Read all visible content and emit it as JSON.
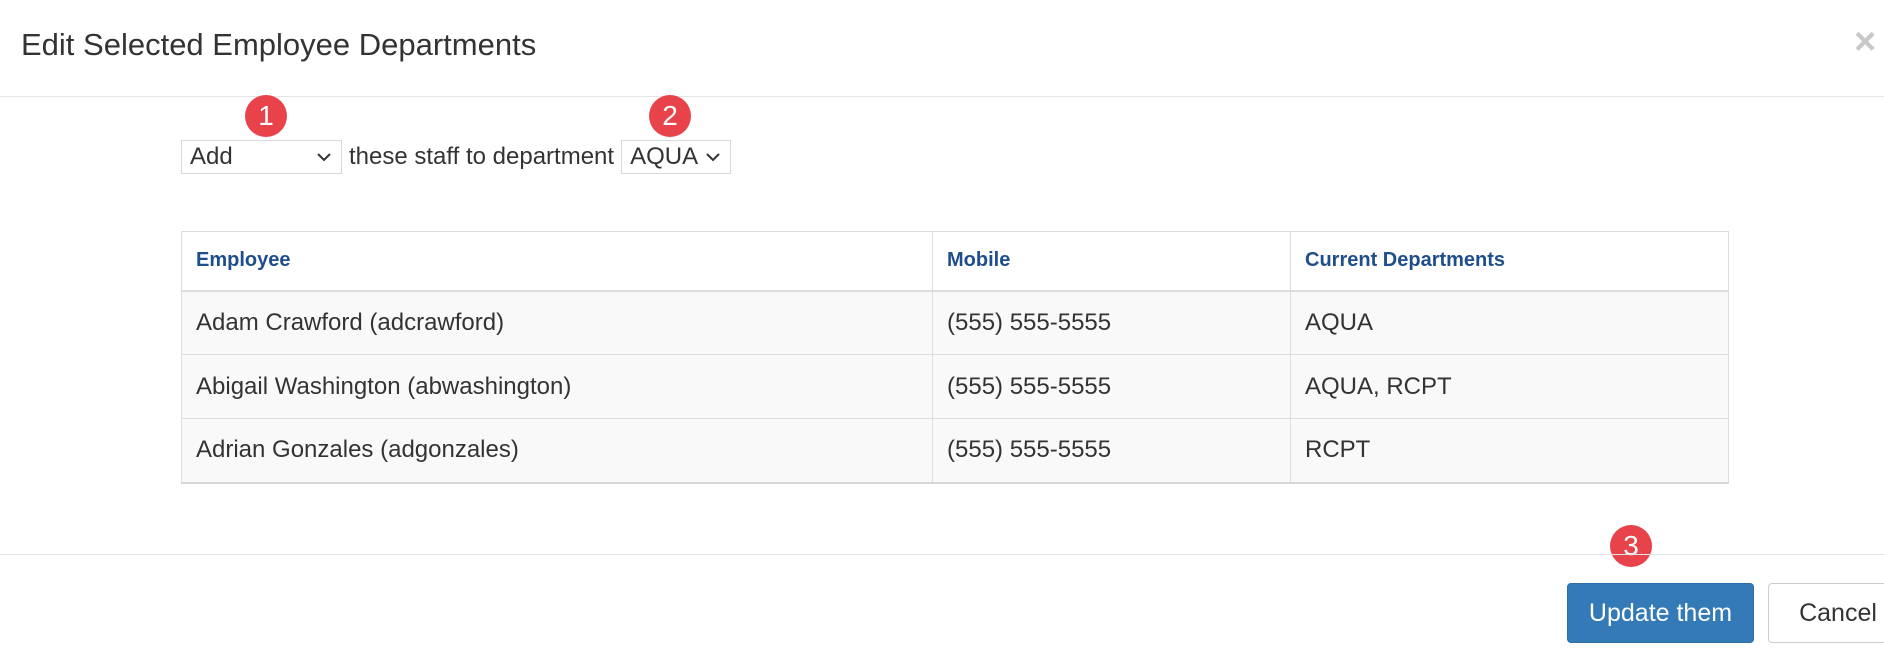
{
  "header": {
    "title": "Edit Selected Employee Departments",
    "close_label": "×"
  },
  "annotations": {
    "badge1": "1",
    "badge2": "2",
    "badge3": "3",
    "color": "#e8424a"
  },
  "controls": {
    "action_value": "Add",
    "middle_text": "these staff to department",
    "department_value": "AQUA"
  },
  "table": {
    "headers": [
      "Employee",
      "Mobile",
      "Current Departments"
    ],
    "rows": [
      {
        "employee": "Adam Crawford (adcrawford)",
        "mobile": "(555) 555-5555",
        "departments": "AQUA"
      },
      {
        "employee": "Abigail Washington (abwashington)",
        "mobile": "(555) 555-5555",
        "departments": "AQUA, RCPT"
      },
      {
        "employee": "Adrian Gonzales (adgonzales)",
        "mobile": "(555) 555-5555",
        "departments": "RCPT"
      }
    ]
  },
  "footer": {
    "update_label": "Update them",
    "cancel_label": "Cancel"
  },
  "colors": {
    "primary": "#337ab7",
    "header_text": "#1f4e8c"
  },
  "icons": {
    "close": "close-icon",
    "chevron": "chevron-down-icon"
  }
}
